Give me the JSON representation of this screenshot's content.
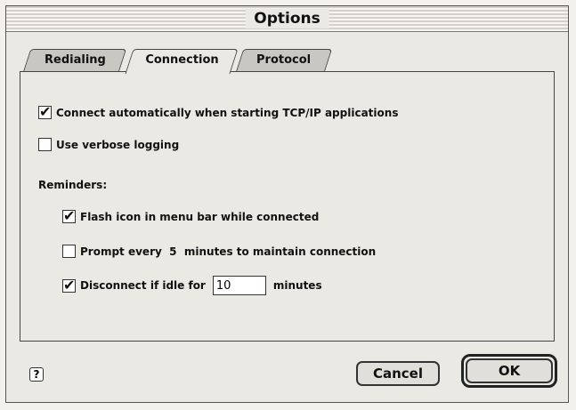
{
  "window": {
    "title": "Options"
  },
  "tabs": [
    {
      "label": "Redialing",
      "active": false
    },
    {
      "label": "Connection",
      "active": true
    },
    {
      "label": "Protocol",
      "active": false
    }
  ],
  "options": {
    "connect_auto": {
      "label": "Connect automatically when starting TCP/IP applications",
      "checked": true
    },
    "verbose_logging": {
      "label": "Use verbose logging",
      "checked": false
    }
  },
  "reminders": {
    "heading": "Reminders:",
    "flash_icon": {
      "label": "Flash icon in menu bar while connected",
      "checked": true
    },
    "prompt": {
      "label": "Prompt every  5  minutes to maintain connection",
      "checked": false
    },
    "disconnect": {
      "label_before": "Disconnect if idle for",
      "value": "10",
      "label_after": "minutes",
      "checked": true
    }
  },
  "help": {
    "label": "?"
  },
  "buttons": {
    "cancel": "Cancel",
    "ok": "OK"
  }
}
